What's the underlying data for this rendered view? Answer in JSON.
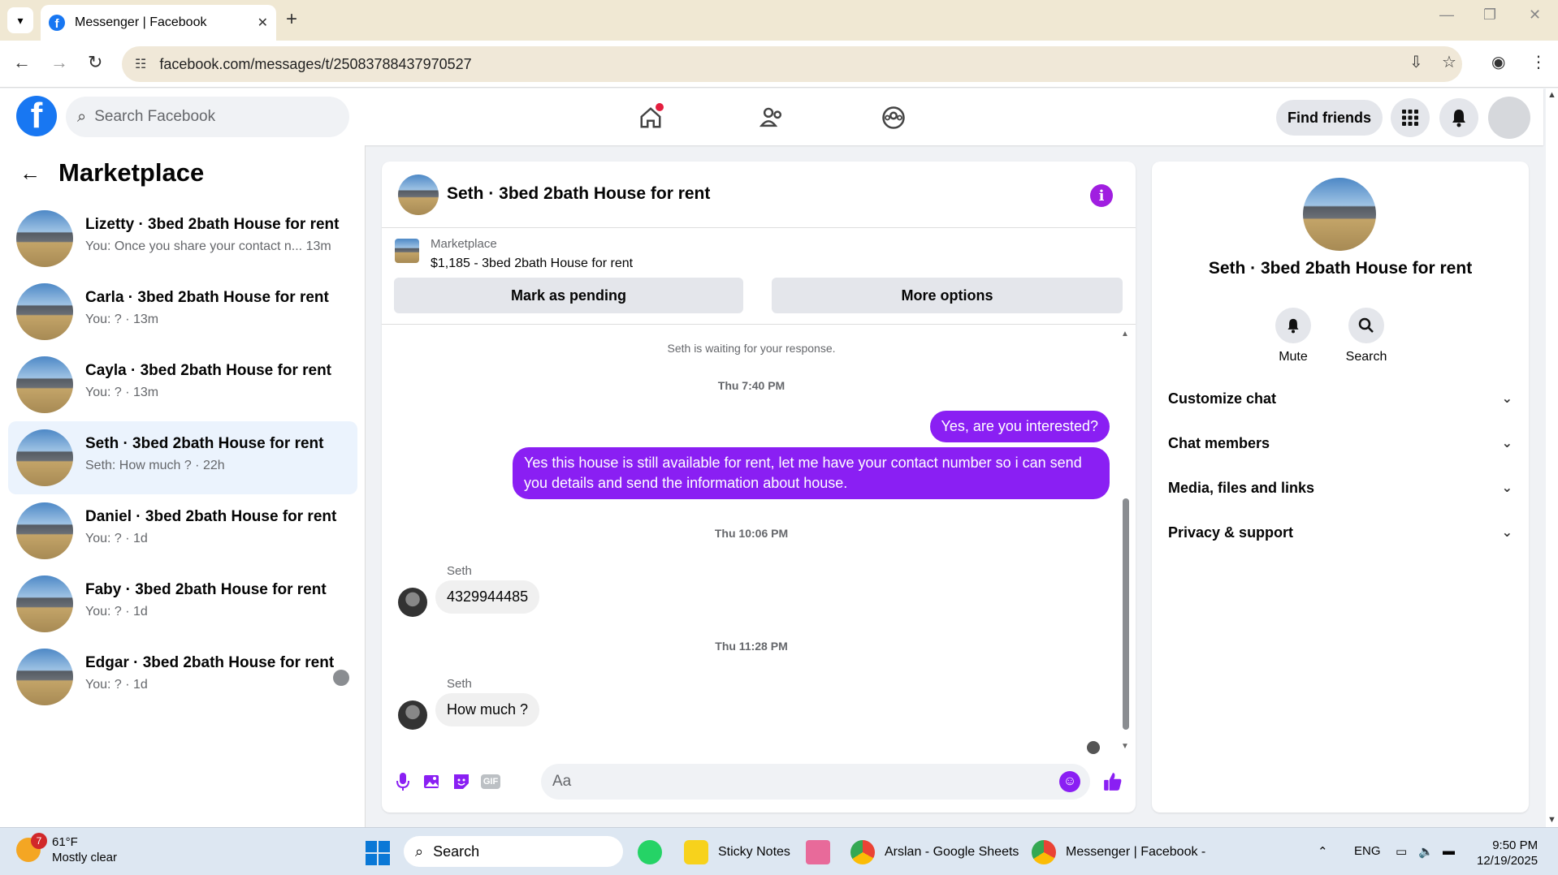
{
  "browser": {
    "tab_title": "Messenger | Facebook",
    "url": "facebook.com/messages/t/25083788437970527"
  },
  "fb": {
    "search_placeholder": "Search Facebook",
    "find_friends": "Find friends"
  },
  "sidebar": {
    "title": "Marketplace",
    "conversations": [
      {
        "name": "Lizetty · 3bed 2bath House for rent",
        "preview": "You: Once you share your contact n...  13m"
      },
      {
        "name": "Carla · 3bed 2bath House for rent",
        "preview": "You: ? · 13m"
      },
      {
        "name": "Cayla · 3bed 2bath House for rent",
        "preview": "You: ? · 13m"
      },
      {
        "name": "Seth · 3bed 2bath House for rent",
        "preview": "Seth: How much ? · 22h"
      },
      {
        "name": "Daniel · 3bed 2bath House for rent",
        "preview": "You: ? · 1d"
      },
      {
        "name": "Faby · 3bed 2bath House for rent",
        "preview": "You: ? · 1d"
      },
      {
        "name": "Edgar · 3bed 2bath House for rent",
        "preview": "You: ? · 1d"
      }
    ]
  },
  "chat": {
    "title": "Seth · 3bed 2bath House for rent",
    "listing_label": "Marketplace",
    "listing_price": "$1,185 - 3bed 2bath House for rent",
    "mark_pending": "Mark as pending",
    "more_options": "More options",
    "waiting": "Seth is waiting for your response.",
    "ts1": "Thu 7:40 PM",
    "out1": "Yes, are you interested?",
    "out2": "Yes this house is still available for rent, let me have your contact number so i can send you details and send the information about house.",
    "ts2": "Thu 10:06 PM",
    "sender": "Seth",
    "in1": "4329944485",
    "ts3": "Thu 11:28 PM",
    "in2": "How much ?",
    "composer_placeholder": "Aa",
    "gif": "GIF"
  },
  "details": {
    "title": "Seth · 3bed 2bath House for rent",
    "mute": "Mute",
    "search": "Search",
    "rows": [
      "Customize chat",
      "Chat members",
      "Media, files and links",
      "Privacy & support"
    ]
  },
  "taskbar": {
    "temp": "61°F",
    "weather": "Mostly clear",
    "weather_badge": "7",
    "search": "Search",
    "apps": [
      "Sticky Notes",
      "Arslan - Google Sheets",
      "Messenger | Facebook -"
    ],
    "lang": "ENG",
    "time": "9:50 PM",
    "date": "12/19/2025"
  },
  "colors": {
    "accent": "#8a1ff3",
    "fb_blue": "#1877f2"
  }
}
